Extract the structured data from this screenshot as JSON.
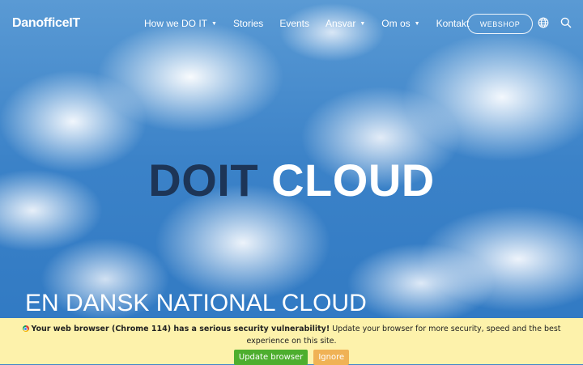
{
  "header": {
    "logo": "DanofficeIT",
    "nav": [
      {
        "label": "How we DO IT",
        "has_dropdown": true
      },
      {
        "label": "Stories",
        "has_dropdown": false
      },
      {
        "label": "Events",
        "has_dropdown": false
      },
      {
        "label": "Ansvar",
        "has_dropdown": true
      },
      {
        "label": "Om os",
        "has_dropdown": true
      },
      {
        "label": "Kontakt",
        "has_dropdown": false
      }
    ],
    "webshop_label": "WEBSHOP",
    "icons": [
      "globe-icon",
      "search-icon"
    ]
  },
  "hero": {
    "title_part1": "DOIT",
    "title_part2": "CLOUD",
    "subtitle": "EN DANSK NATIONAL CLOUD"
  },
  "banner": {
    "bold": "Your web browser (Chrome 114) has a serious security vulnerability!",
    "text": " Update your browser for more security, speed and the best experience on this site.",
    "update_label": "Update browser",
    "ignore_label": "Ignore"
  },
  "colors": {
    "title_dark": "#1d3557",
    "update_button": "#4dae2e",
    "ignore_button": "#f0b255",
    "banner_bg": "#fdf2ab"
  }
}
